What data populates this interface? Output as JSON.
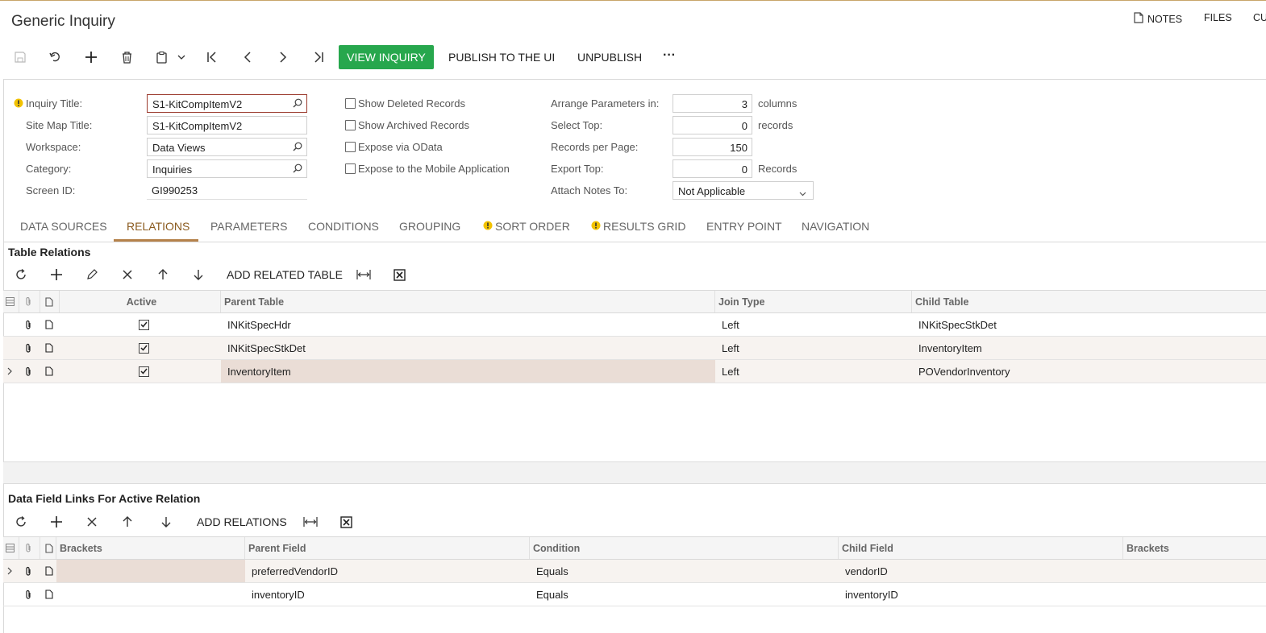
{
  "window": {
    "title": "Generic Inquiry"
  },
  "header_links": {
    "notes": "NOTES",
    "files": "FILES",
    "customization": "CU"
  },
  "toolbar": {
    "view_inquiry": "VIEW INQUIRY",
    "publish": "PUBLISH TO THE UI",
    "unpublish": "UNPUBLISH",
    "more": "···"
  },
  "form": {
    "inquiry_title": {
      "label": "Inquiry Title:",
      "value": "S1-KitCompItemV2"
    },
    "site_map_title": {
      "label": "Site Map Title:",
      "value": "S1-KitCompItemV2"
    },
    "workspace": {
      "label": "Workspace:",
      "value": "Data Views"
    },
    "category": {
      "label": "Category:",
      "value": "Inquiries"
    },
    "screen_id": {
      "label": "Screen ID:",
      "value": "GI990253"
    },
    "show_deleted": "Show Deleted Records",
    "show_archived": "Show Archived Records",
    "expose_odata": "Expose via OData",
    "expose_mobile": "Expose to the Mobile Application",
    "arrange_params": {
      "label": "Arrange Parameters in:",
      "value": "3",
      "suffix": "columns"
    },
    "select_top": {
      "label": "Select Top:",
      "value": "0",
      "suffix": "records"
    },
    "records_per_page": {
      "label": "Records per Page:",
      "value": "150"
    },
    "export_top": {
      "label": "Export Top:",
      "value": "0",
      "suffix": "Records"
    },
    "attach_notes": {
      "label": "Attach Notes To:",
      "value": "Not Applicable"
    }
  },
  "tabs": [
    {
      "label": "DATA SOURCES"
    },
    {
      "label": "RELATIONS"
    },
    {
      "label": "PARAMETERS"
    },
    {
      "label": "CONDITIONS"
    },
    {
      "label": "GROUPING"
    },
    {
      "label": "SORT ORDER"
    },
    {
      "label": "RESULTS GRID"
    },
    {
      "label": "ENTRY POINT"
    },
    {
      "label": "NAVIGATION"
    }
  ],
  "table_relations": {
    "title": "Table Relations",
    "add_button": "ADD RELATED TABLE",
    "columns": [
      "Active",
      "Parent Table",
      "Join Type",
      "Child Table"
    ],
    "rows": [
      {
        "active": true,
        "parent": "INKitSpecHdr",
        "join": "Left",
        "child": "INKitSpecStkDet"
      },
      {
        "active": true,
        "parent": "INKitSpecStkDet",
        "join": "Left",
        "child": "InventoryItem"
      },
      {
        "active": true,
        "parent": "InventoryItem",
        "join": "Left",
        "child": "POVendorInventory"
      }
    ]
  },
  "data_field_links": {
    "title": "Data Field Links For Active Relation",
    "add_button": "ADD RELATIONS",
    "columns": [
      "Brackets",
      "Parent Field",
      "Condition",
      "Child Field",
      "Brackets"
    ],
    "rows": [
      {
        "brackets_open": "",
        "parent_field": "preferredVendorID",
        "condition": "Equals",
        "child_field": "vendorID",
        "brackets_close": ""
      },
      {
        "brackets_open": "",
        "parent_field": "inventoryID",
        "condition": "Equals",
        "child_field": "inventoryID",
        "brackets_close": ""
      }
    ]
  },
  "colors": {
    "accent": "#27a74d",
    "tab_active": "#8a5a1e",
    "warning": "#f2c200"
  }
}
